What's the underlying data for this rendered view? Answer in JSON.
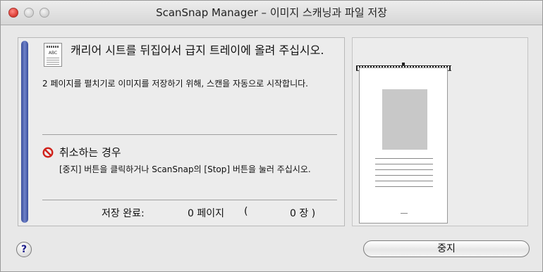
{
  "window": {
    "title": "ScanSnap Manager – 이미지 스캐닝과 파일 저장"
  },
  "instruction": {
    "main": "캐리어 시트를 뒤집어서 급지 트레이에 올려 주십시오.",
    "sub": "2 페이지를 펼치기로 이미지를 저장하기 위해, 스캔을 자동으로 시작합니다.",
    "doc_icon_text": "ABC"
  },
  "cancel": {
    "title": "취소하는 경우",
    "description": "[중지] 버튼을 클릭하거나 ScanSnap의 [Stop] 버튼을 눌러 주십시오."
  },
  "status": {
    "saved_label": "저장 완료:",
    "pages_text": "0 페이지",
    "paren_open": "(",
    "sheets_text": "0 장 )"
  },
  "buttons": {
    "help_label": "?",
    "stop_label": "중지"
  },
  "colors": {
    "progress_bar": "#3a4e9c",
    "stop_icon": "#d0211a"
  },
  "icons": {
    "help": "help-icon",
    "stop": "prohibited-icon",
    "document": "document-icon"
  }
}
